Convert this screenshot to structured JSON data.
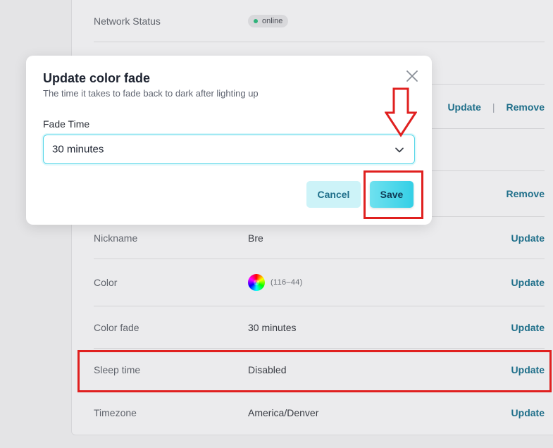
{
  "settings": {
    "rows": [
      {
        "label": "Network Status",
        "badge": "online"
      },
      {
        "label": "",
        "value": ""
      },
      {
        "label": "",
        "actions": [
          "Update",
          "Remove"
        ]
      },
      {
        "label": "",
        "value": ""
      },
      {
        "label": "",
        "actions": [
          "Remove"
        ]
      },
      {
        "label": "Nickname",
        "value": "Bre",
        "action": "Update"
      },
      {
        "label": "Color",
        "value": "(116–44)",
        "action": "Update"
      },
      {
        "label": "Color fade",
        "value": "30 minutes",
        "action": "Update"
      },
      {
        "label": "Sleep time",
        "value": "Disabled",
        "action": "Update"
      },
      {
        "label": "Timezone",
        "value": "America/Denver",
        "action": "Update"
      }
    ],
    "separator": "|"
  },
  "modal": {
    "title": "Update color fade",
    "subtitle": "The time it takes to fade back to dark after lighting up",
    "field_label": "Fade Time",
    "selected_value": "30 minutes",
    "cancel_label": "Cancel",
    "save_label": "Save"
  },
  "colors": {
    "accent": "#1f6f8a",
    "primary_button": "#34cfe6",
    "annotation": "#e0201f",
    "status_online": "#2fb27a"
  },
  "icons": {
    "close": "close-icon",
    "chevron": "chevron-down-icon",
    "arrow": "down-arrow-annotation"
  }
}
